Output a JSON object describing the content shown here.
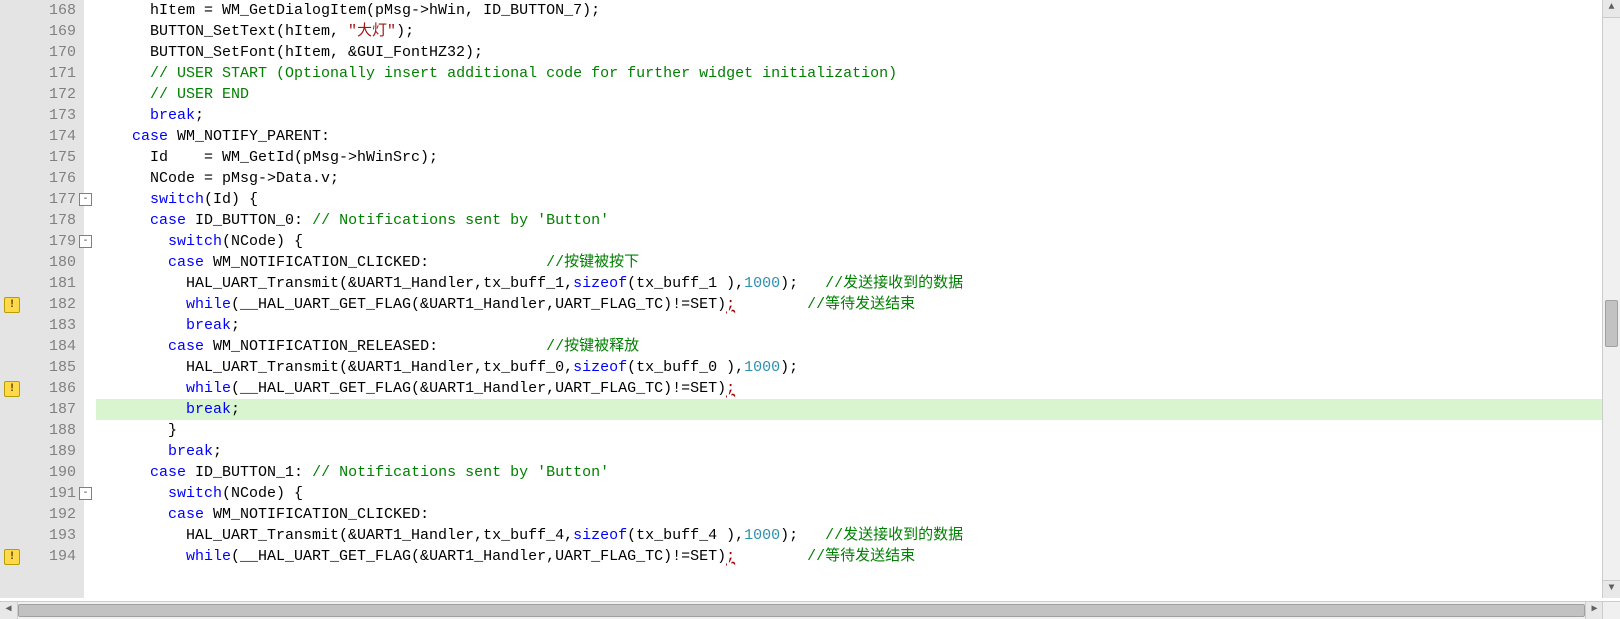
{
  "scrollbar": {
    "up": "▲",
    "down": "▼",
    "left": "◀",
    "right": "▶"
  },
  "lines": [
    {
      "n": 168,
      "warn": false,
      "fold": "",
      "hl": false,
      "tokens": [
        {
          "c": "txt",
          "t": "      hItem = WM_GetDialogItem(pMsg->hWin, ID_BUTTON_7);"
        }
      ]
    },
    {
      "n": 169,
      "warn": false,
      "fold": "",
      "hl": false,
      "tokens": [
        {
          "c": "txt",
          "t": "      BUTTON_SetText(hItem, "
        },
        {
          "c": "str",
          "t": "\"大灯\""
        },
        {
          "c": "txt",
          "t": ");"
        }
      ]
    },
    {
      "n": 170,
      "warn": false,
      "fold": "",
      "hl": false,
      "tokens": [
        {
          "c": "txt",
          "t": "      BUTTON_SetFont(hItem, &GUI_FontHZ32);"
        }
      ]
    },
    {
      "n": 171,
      "warn": false,
      "fold": "",
      "hl": false,
      "tokens": [
        {
          "c": "txt",
          "t": "      "
        },
        {
          "c": "cmt",
          "t": "// USER START (Optionally insert additional code for further widget initialization)"
        }
      ]
    },
    {
      "n": 172,
      "warn": false,
      "fold": "",
      "hl": false,
      "tokens": [
        {
          "c": "txt",
          "t": "      "
        },
        {
          "c": "cmt",
          "t": "// USER END"
        }
      ]
    },
    {
      "n": 173,
      "warn": false,
      "fold": "",
      "hl": false,
      "tokens": [
        {
          "c": "txt",
          "t": "      "
        },
        {
          "c": "kw",
          "t": "break"
        },
        {
          "c": "txt",
          "t": ";"
        }
      ]
    },
    {
      "n": 174,
      "warn": false,
      "fold": "",
      "hl": false,
      "tokens": [
        {
          "c": "txt",
          "t": "    "
        },
        {
          "c": "kw",
          "t": "case"
        },
        {
          "c": "txt",
          "t": " WM_NOTIFY_PARENT:"
        }
      ]
    },
    {
      "n": 175,
      "warn": false,
      "fold": "",
      "hl": false,
      "tokens": [
        {
          "c": "txt",
          "t": "      Id    = WM_GetId(pMsg->hWinSrc);"
        }
      ]
    },
    {
      "n": 176,
      "warn": false,
      "fold": "",
      "hl": false,
      "tokens": [
        {
          "c": "txt",
          "t": "      NCode = pMsg->Data.v;"
        }
      ]
    },
    {
      "n": 177,
      "warn": false,
      "fold": "-",
      "hl": false,
      "tokens": [
        {
          "c": "txt",
          "t": "      "
        },
        {
          "c": "kw",
          "t": "switch"
        },
        {
          "c": "txt",
          "t": "(Id) {"
        }
      ]
    },
    {
      "n": 178,
      "warn": false,
      "fold": "",
      "hl": false,
      "tokens": [
        {
          "c": "txt",
          "t": "      "
        },
        {
          "c": "kw",
          "t": "case"
        },
        {
          "c": "txt",
          "t": " ID_BUTTON_0: "
        },
        {
          "c": "cmt",
          "t": "// Notifications sent by 'Button'"
        }
      ]
    },
    {
      "n": 179,
      "warn": false,
      "fold": "-",
      "hl": false,
      "tokens": [
        {
          "c": "txt",
          "t": "        "
        },
        {
          "c": "kw",
          "t": "switch"
        },
        {
          "c": "txt",
          "t": "(NCode) {"
        }
      ]
    },
    {
      "n": 180,
      "warn": false,
      "fold": "",
      "hl": false,
      "tokens": [
        {
          "c": "txt",
          "t": "        "
        },
        {
          "c": "kw",
          "t": "case"
        },
        {
          "c": "txt",
          "t": " WM_NOTIFICATION_CLICKED:             "
        },
        {
          "c": "cmt",
          "t": "//按键被按下"
        }
      ]
    },
    {
      "n": 181,
      "warn": false,
      "fold": "",
      "hl": false,
      "tokens": [
        {
          "c": "txt",
          "t": "          HAL_UART_Transmit(&UART1_Handler,tx_buff_1,"
        },
        {
          "c": "kw",
          "t": "sizeof"
        },
        {
          "c": "txt",
          "t": "(tx_buff_1 ),"
        },
        {
          "c": "num",
          "t": "1000"
        },
        {
          "c": "txt",
          "t": ");   "
        },
        {
          "c": "cmt",
          "t": "//发送接收到的数据"
        }
      ]
    },
    {
      "n": 182,
      "warn": true,
      "fold": "",
      "hl": false,
      "tokens": [
        {
          "c": "txt",
          "t": "          "
        },
        {
          "c": "kw",
          "t": "while"
        },
        {
          "c": "txt",
          "t": "(__HAL_UART_GET_FLAG(&UART1_Handler,UART_FLAG_TC)!=SET)"
        },
        {
          "c": "err",
          "t": ";"
        },
        {
          "c": "txt",
          "t": "        "
        },
        {
          "c": "cmt",
          "t": "//等待发送结束"
        }
      ]
    },
    {
      "n": 183,
      "warn": false,
      "fold": "",
      "hl": false,
      "tokens": [
        {
          "c": "txt",
          "t": "          "
        },
        {
          "c": "kw",
          "t": "break"
        },
        {
          "c": "txt",
          "t": ";"
        }
      ]
    },
    {
      "n": 184,
      "warn": false,
      "fold": "",
      "hl": false,
      "tokens": [
        {
          "c": "txt",
          "t": "        "
        },
        {
          "c": "kw",
          "t": "case"
        },
        {
          "c": "txt",
          "t": " WM_NOTIFICATION_RELEASED:            "
        },
        {
          "c": "cmt",
          "t": "//按键被释放"
        }
      ]
    },
    {
      "n": 185,
      "warn": false,
      "fold": "",
      "hl": false,
      "tokens": [
        {
          "c": "txt",
          "t": "          HAL_UART_Transmit(&UART1_Handler,tx_buff_0,"
        },
        {
          "c": "kw",
          "t": "sizeof"
        },
        {
          "c": "txt",
          "t": "(tx_buff_0 ),"
        },
        {
          "c": "num",
          "t": "1000"
        },
        {
          "c": "txt",
          "t": ");"
        }
      ]
    },
    {
      "n": 186,
      "warn": true,
      "fold": "",
      "hl": false,
      "tokens": [
        {
          "c": "txt",
          "t": "          "
        },
        {
          "c": "kw",
          "t": "while"
        },
        {
          "c": "txt",
          "t": "(__HAL_UART_GET_FLAG(&UART1_Handler,UART_FLAG_TC)!=SET)"
        },
        {
          "c": "err",
          "t": ";"
        }
      ]
    },
    {
      "n": 187,
      "warn": false,
      "fold": "",
      "hl": true,
      "tokens": [
        {
          "c": "txt",
          "t": "          "
        },
        {
          "c": "kw",
          "t": "break"
        },
        {
          "c": "txt",
          "t": ";"
        }
      ]
    },
    {
      "n": 188,
      "warn": false,
      "fold": "",
      "hl": false,
      "tokens": [
        {
          "c": "txt",
          "t": "        }"
        }
      ]
    },
    {
      "n": 189,
      "warn": false,
      "fold": "",
      "hl": false,
      "tokens": [
        {
          "c": "txt",
          "t": "        "
        },
        {
          "c": "kw",
          "t": "break"
        },
        {
          "c": "txt",
          "t": ";"
        }
      ]
    },
    {
      "n": 190,
      "warn": false,
      "fold": "",
      "hl": false,
      "tokens": [
        {
          "c": "txt",
          "t": "      "
        },
        {
          "c": "kw",
          "t": "case"
        },
        {
          "c": "txt",
          "t": " ID_BUTTON_1: "
        },
        {
          "c": "cmt",
          "t": "// Notifications sent by 'Button'"
        }
      ]
    },
    {
      "n": 191,
      "warn": false,
      "fold": "-",
      "hl": false,
      "tokens": [
        {
          "c": "txt",
          "t": "        "
        },
        {
          "c": "kw",
          "t": "switch"
        },
        {
          "c": "txt",
          "t": "(NCode) {"
        }
      ]
    },
    {
      "n": 192,
      "warn": false,
      "fold": "",
      "hl": false,
      "tokens": [
        {
          "c": "txt",
          "t": "        "
        },
        {
          "c": "kw",
          "t": "case"
        },
        {
          "c": "txt",
          "t": " WM_NOTIFICATION_CLICKED:"
        }
      ]
    },
    {
      "n": 193,
      "warn": false,
      "fold": "",
      "hl": false,
      "tokens": [
        {
          "c": "txt",
          "t": "          HAL_UART_Transmit(&UART1_Handler,tx_buff_4,"
        },
        {
          "c": "kw",
          "t": "sizeof"
        },
        {
          "c": "txt",
          "t": "(tx_buff_4 ),"
        },
        {
          "c": "num",
          "t": "1000"
        },
        {
          "c": "txt",
          "t": ");   "
        },
        {
          "c": "cmt",
          "t": "//发送接收到的数据"
        }
      ]
    },
    {
      "n": 194,
      "warn": true,
      "fold": "",
      "hl": false,
      "tokens": [
        {
          "c": "txt",
          "t": "          "
        },
        {
          "c": "kw",
          "t": "while"
        },
        {
          "c": "txt",
          "t": "(__HAL_UART_GET_FLAG(&UART1_Handler,UART_FLAG_TC)!=SET)"
        },
        {
          "c": "err",
          "t": ";"
        },
        {
          "c": "txt",
          "t": "        "
        },
        {
          "c": "cmt",
          "t": "//等待发送结束"
        }
      ]
    }
  ]
}
